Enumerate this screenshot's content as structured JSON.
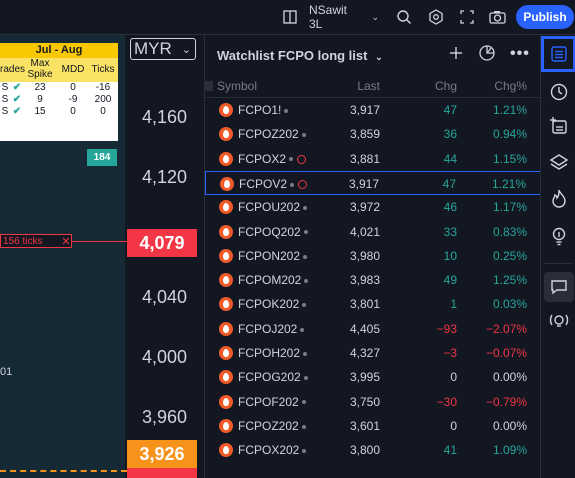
{
  "topbar": {
    "layout_name": "NSawit 3L",
    "publish_label": "Publish"
  },
  "chart": {
    "currency": "MYR",
    "stats": {
      "header": "Jul - Aug",
      "columns": [
        "rades",
        "Max\nSpike",
        "MDD",
        "Ticks"
      ],
      "col_trades": "rades",
      "col_spike": "Max Spike",
      "col_mdd": "MDD",
      "col_ticks": "Ticks",
      "rows": [
        {
          "label": "S",
          "spike": "23",
          "mdd": "0",
          "ticks": "-16"
        },
        {
          "label": "S",
          "spike": "9",
          "mdd": "-9",
          "ticks": "200"
        },
        {
          "label": "S",
          "spike": "15",
          "mdd": "0",
          "ticks": "0"
        }
      ],
      "ticks_badge": "184"
    },
    "price_labels": [
      "4,160",
      "4,120",
      "4,040",
      "4,000",
      "3,960"
    ],
    "tick_label": "156 ticks",
    "current_price": "4,079",
    "orange_price": "3,926",
    "chart_tag": "01",
    "colors": {
      "red": "#f23645",
      "orange": "#f7931a",
      "green": "#26a69a"
    }
  },
  "watchlist": {
    "title": "Watchlist FCPO long list",
    "col_symbol": "Symbol",
    "col_last": "Last",
    "col_chg": "Chg",
    "col_pct": "Chg%",
    "rows": [
      {
        "sym": "FCPO1!",
        "last": "3,917",
        "chg": "47",
        "pct": "1.21%",
        "dir": "pos",
        "clock": false
      },
      {
        "sym": "FCPOZ202",
        "last": "3,859",
        "chg": "36",
        "pct": "0.94%",
        "dir": "pos",
        "clock": false
      },
      {
        "sym": "FCPOX2",
        "last": "3,881",
        "chg": "44",
        "pct": "1.15%",
        "dir": "pos",
        "clock": true
      },
      {
        "sym": "FCPOV2",
        "last": "3,917",
        "chg": "47",
        "pct": "1.21%",
        "dir": "pos",
        "clock": true
      },
      {
        "sym": "FCPOU202",
        "last": "3,972",
        "chg": "46",
        "pct": "1.17%",
        "dir": "pos",
        "clock": false
      },
      {
        "sym": "FCPOQ202",
        "last": "4,021",
        "chg": "33",
        "pct": "0.83%",
        "dir": "pos",
        "clock": false
      },
      {
        "sym": "FCPON202",
        "last": "3,980",
        "chg": "10",
        "pct": "0.25%",
        "dir": "pos",
        "clock": false
      },
      {
        "sym": "FCPOM202",
        "last": "3,983",
        "chg": "49",
        "pct": "1.25%",
        "dir": "pos",
        "clock": false
      },
      {
        "sym": "FCPOK202",
        "last": "3,801",
        "chg": "1",
        "pct": "0.03%",
        "dir": "pos",
        "clock": false
      },
      {
        "sym": "FCPOJ202",
        "last": "4,405",
        "chg": "−93",
        "pct": "−2.07%",
        "dir": "neg",
        "clock": false
      },
      {
        "sym": "FCPOH202",
        "last": "4,327",
        "chg": "−3",
        "pct": "−0.07%",
        "dir": "neg",
        "clock": false
      },
      {
        "sym": "FCPOG202",
        "last": "3,995",
        "chg": "0",
        "pct": "0.00%",
        "dir": "zero",
        "clock": false
      },
      {
        "sym": "FCPOF202",
        "last": "3,750",
        "chg": "−30",
        "pct": "−0.79%",
        "dir": "neg",
        "clock": false
      },
      {
        "sym": "FCPOZ202",
        "last": "3,601",
        "chg": "0",
        "pct": "0.00%",
        "dir": "zero",
        "clock": false
      },
      {
        "sym": "FCPOX202",
        "last": "3,800",
        "chg": "41",
        "pct": "1.09%",
        "dir": "pos",
        "clock": false
      }
    ],
    "selected_index": 3
  },
  "sidebar": {
    "icons": [
      "watchlist-icon",
      "alerts-clock-icon",
      "add-note-icon",
      "layers-icon",
      "hotlist-flame-icon",
      "ideas-bulb-icon",
      "chat-icon",
      "streams-icon"
    ]
  }
}
